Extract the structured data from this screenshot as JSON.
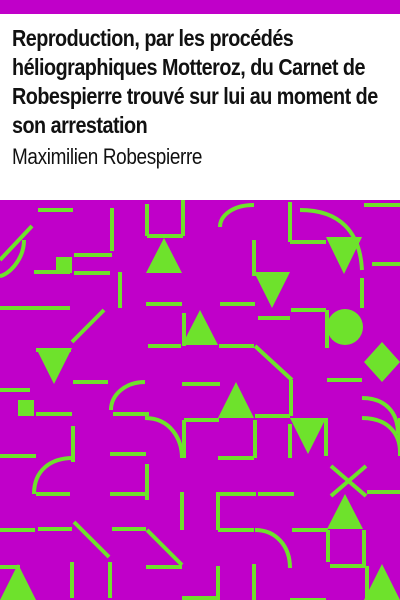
{
  "book": {
    "title": "Reproduction, par les procédés héliographiques Motteroz, du Carnet de Robespierre trouvé sur lui au moment de son arrestation",
    "author": "Maximilien Robespierre"
  },
  "colors": {
    "background": "#c000c9",
    "pattern": "#6ee22c",
    "text": "#111111"
  }
}
